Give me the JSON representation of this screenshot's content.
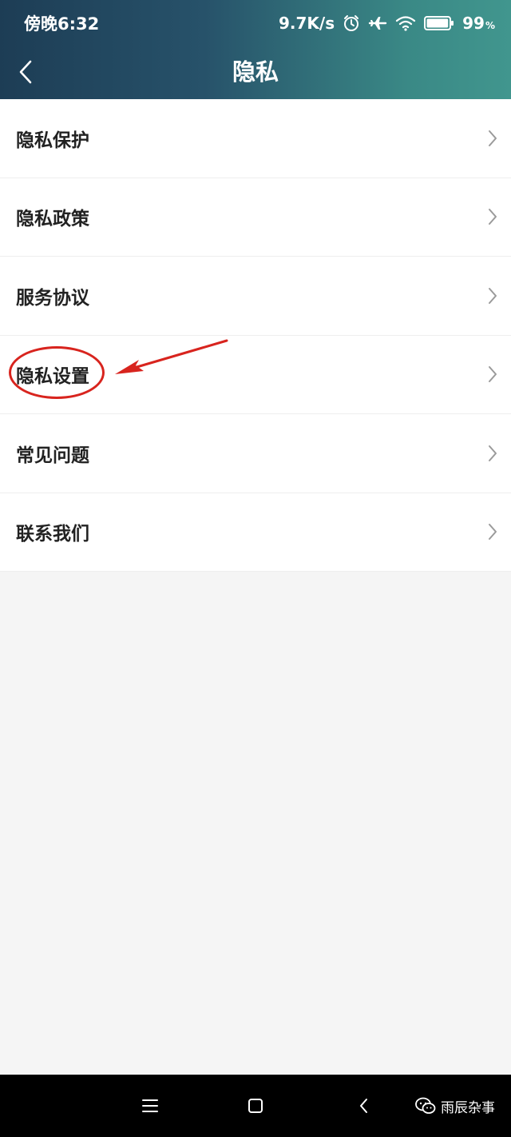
{
  "status_bar": {
    "time": "傍晚6:32",
    "net_speed": "9.7K/s",
    "battery_percent": "99",
    "battery_unit": "%",
    "battery_level": 0.99,
    "icons": [
      "alarm-icon",
      "airplane-mode-icon",
      "wifi-icon",
      "battery-icon"
    ]
  },
  "header": {
    "title": "隐私",
    "back_icon": "chevron-left-icon"
  },
  "menu": {
    "items": [
      {
        "label": "隐私保护"
      },
      {
        "label": "隐私政策"
      },
      {
        "label": "服务协议"
      },
      {
        "label": "隐私设置"
      },
      {
        "label": "常见问题"
      },
      {
        "label": "联系我们"
      }
    ],
    "chevron_icon": "chevron-right-icon",
    "highlighted_index": 3
  },
  "annotation": {
    "color": "#d8241e",
    "target": "隐私设置"
  },
  "nav_bar": {
    "buttons": [
      "menu-icon",
      "home-icon",
      "back-icon"
    ]
  },
  "watermark": {
    "text": "雨辰杂事",
    "icon": "wechat-icon"
  },
  "colors": {
    "header_start": "#1d3d55",
    "header_end": "#41968e",
    "background": "#f5f5f5",
    "item_background": "#ffffff"
  }
}
